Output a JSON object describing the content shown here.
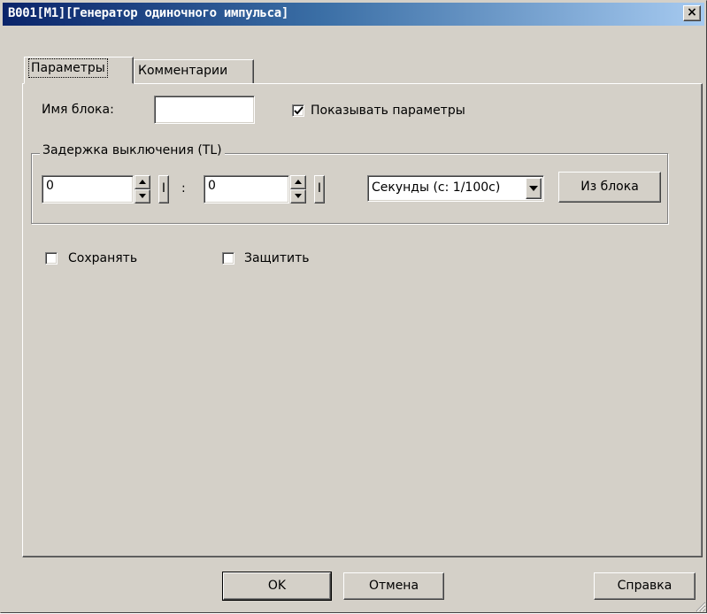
{
  "window": {
    "title": "B001[M1][Генератор одиночного импульса]",
    "close_glyph": "×"
  },
  "tabs": [
    {
      "label": "Параметры",
      "active": true
    },
    {
      "label": "Комментарии",
      "active": false
    }
  ],
  "block_name": {
    "label": "Имя блока:",
    "value": ""
  },
  "show_params": {
    "label": "Показывать параметры",
    "checked": true
  },
  "delay_group": {
    "legend": "Задержка выключения (TL)",
    "value1": "0",
    "value2": "0",
    "separator": ":",
    "ibtn_label": "I",
    "units_selected": "Секунды (с: 1/100с)",
    "from_block_label": "Из блока"
  },
  "retain": {
    "label": "Сохранять",
    "checked": false
  },
  "protect": {
    "label": "Защитить",
    "checked": false
  },
  "buttons": {
    "ok": "OK",
    "cancel": "Отмена",
    "help": "Справка"
  },
  "icons": {
    "close": "close-icon",
    "spin_up": "spin-up-icon",
    "spin_down": "spin-down-icon",
    "dropdown": "chevron-down-icon",
    "check": "checkmark-icon",
    "resize": "resize-grip-icon"
  },
  "colors": {
    "face": "#d4d0c8",
    "title_start": "#0a246a",
    "title_end": "#a6caf0"
  }
}
